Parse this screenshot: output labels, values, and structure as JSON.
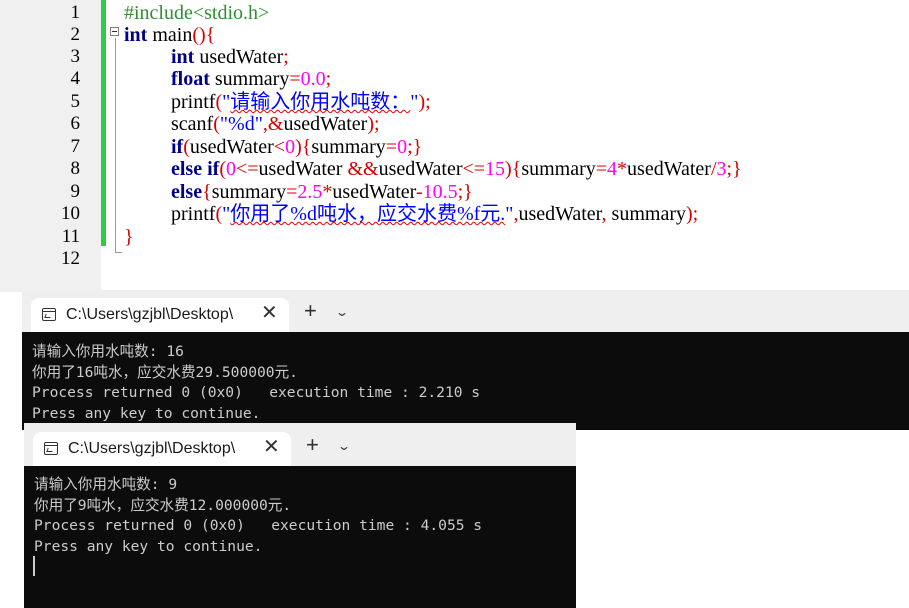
{
  "editor": {
    "line_numbers": [
      "1",
      "2",
      "3",
      "4",
      "5",
      "6",
      "7",
      "8",
      "9",
      "10",
      "11",
      "12"
    ],
    "lines": {
      "l1": {
        "include": "#include<stdio.h>"
      },
      "l2": {
        "int": "int",
        "main": " main",
        "paren": "()",
        "brace": "{"
      },
      "l3": {
        "int": "int",
        "rest": " usedWater",
        "semi": ";"
      },
      "l4": {
        "float": "float",
        "rest": " summary",
        "eq": "=",
        "num": "0.0",
        "semi": ";"
      },
      "l5": {
        "fn": "printf",
        "open": "(",
        "q1": "\"",
        "text": "请输入你用水吨数：",
        "q2": "\"",
        "close": ");"
      },
      "l6": {
        "fn": "scanf",
        "open": "(",
        "str": "\"%d\"",
        "comma": ",",
        "amp": "&",
        "var": "usedWater",
        "close": ");"
      },
      "l7": {
        "if": "if",
        "open": "(",
        "var": "usedWater",
        "lt": "<",
        "num": "0",
        "close": ")",
        "b1": "{",
        "inner": "summary",
        "eq": "=",
        "num2": "0",
        "semi": ";",
        "b2": "}"
      },
      "l8": {
        "else": "else",
        "if": "if",
        "open": "(",
        "num": "0",
        "le": "<=",
        "var1": "usedWater ",
        "and": "&&",
        "var2": "usedWater",
        "le2": "<=",
        "num2": "15",
        "close": ")",
        "b1": "{",
        "sum": "summary",
        "eq": "=",
        "num3": "4",
        "mul": "*",
        "var3": "usedWater",
        "div": "/",
        "num4": "3",
        "semi": ";",
        "b2": "}"
      },
      "l9": {
        "else": "else",
        "b1": "{",
        "sum": "summary",
        "eq": "=",
        "num": "2.5",
        "mul": "*",
        "var": "usedWater",
        "minus": "-",
        "num2": "10.5",
        "semi": ";",
        "b2": "}"
      },
      "l10": {
        "fn": "printf",
        "open": "(",
        "q1": "\"",
        "text": "你用了%d吨水，应交水费%f元.",
        "q2": "\"",
        "comma": ",",
        "args": "usedWater",
        "comma2": ",",
        "args2": " summary",
        "close": ");"
      },
      "l11": {
        "brace": "}"
      }
    }
  },
  "consoles": [
    {
      "tab_title": "C:\\Users\\gzjbl\\Desktop\\",
      "close_glyph": "✕",
      "new_tab_glyph": "+",
      "dropdown_glyph": "⌄",
      "output": [
        "请输入你用水吨数: 16",
        "你用了16吨水，应交水费29.500000元.",
        "Process returned 0 (0x0)   execution time : 2.210 s",
        "Press any key to continue."
      ]
    },
    {
      "tab_title": "C:\\Users\\gzjbl\\Desktop\\",
      "close_glyph": "✕",
      "new_tab_glyph": "+",
      "dropdown_glyph": "⌄",
      "output": [
        "请输入你用水吨数: 9",
        "你用了9吨水，应交水费12.000000元.",
        "Process returned 0 (0x0)   execution time : 4.055 s",
        "Press any key to continue."
      ]
    }
  ],
  "colors": {
    "keyword": "#00008b",
    "preprocessor": "#2f8f2f",
    "operator": "#d60000",
    "number": "#ff00ff",
    "string": "#0000ff",
    "change_bar": "#2ecc40",
    "console_bg": "#0c0c0c",
    "console_text": "#cccccc"
  },
  "icons": {
    "tab_icon": "terminal-icon",
    "close": "close-icon",
    "new_tab": "plus-icon",
    "dropdown": "chevron-down-icon",
    "fold": "fold-collapse-icon"
  }
}
